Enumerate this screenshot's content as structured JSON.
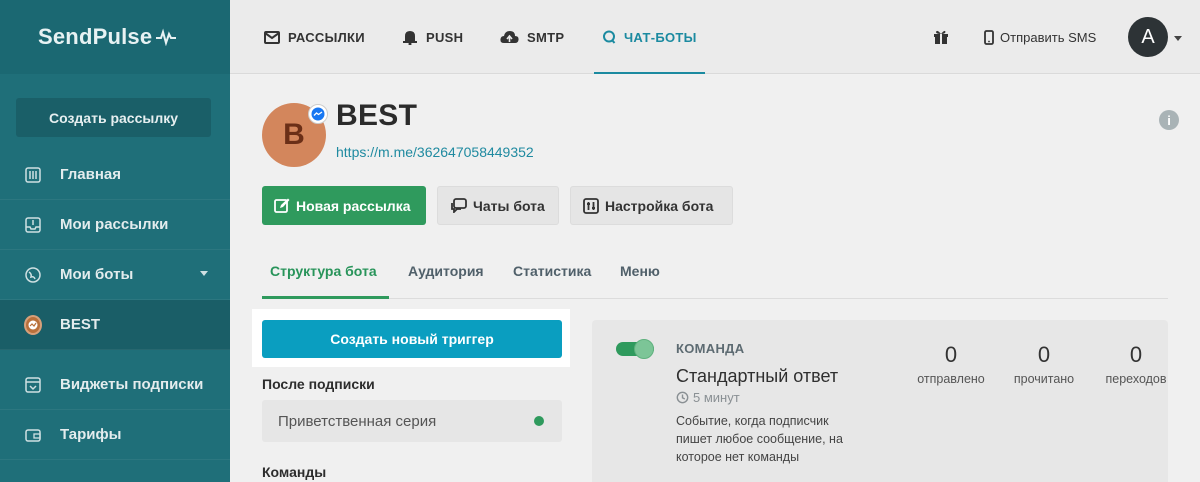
{
  "brand": {
    "name": "SendPulse"
  },
  "sidebar": {
    "create_label": "Создать рассылку",
    "items": [
      {
        "label": "Главная",
        "icon": "sliders-icon"
      },
      {
        "label": "Мои рассылки",
        "icon": "inbox-icon"
      },
      {
        "label": "Мои боты",
        "icon": "globe-icon"
      },
      {
        "label": "BEST",
        "icon": "messenger-icon"
      },
      {
        "label": "Виджеты подписки",
        "icon": "widget-icon"
      },
      {
        "label": "Тарифы",
        "icon": "wallet-icon"
      }
    ]
  },
  "header": {
    "tabs": [
      {
        "label": "РАССЫЛКИ",
        "icon": "envelope-icon"
      },
      {
        "label": "PUSH",
        "icon": "bell-icon"
      },
      {
        "label": "SMTP",
        "icon": "cloud-upload-icon"
      },
      {
        "label": "ЧАТ-БОТЫ",
        "icon": "chat-icon"
      }
    ],
    "sms_label": "Отправить SMS",
    "avatar_letter": "A"
  },
  "bot": {
    "initial": "B",
    "title": "BEST",
    "link": "https://m.me/362647058449352"
  },
  "actions": {
    "new_mailing": "Новая рассылка",
    "bot_chats": "Чаты бота",
    "bot_settings": "Настройка бота"
  },
  "subtabs": [
    "Структура бота",
    "Аудитория",
    "Статистика",
    "Меню"
  ],
  "triggers": {
    "create_label": "Создать новый триггер",
    "after_subscribe_label": "После подписки",
    "welcome_series": "Приветственная серия",
    "commands_label": "Команды"
  },
  "card": {
    "type": "КОМАНДА",
    "title": "Стандартный ответ",
    "time": "5 минут",
    "description": "Событие, когда подписчик пишет любое сообщение, на которое нет команды",
    "stats": [
      {
        "value": "0",
        "label": "отправлено"
      },
      {
        "value": "0",
        "label": "прочитано"
      },
      {
        "value": "0",
        "label": "переходов"
      }
    ]
  },
  "colors": {
    "sidebar": "#1f6f79",
    "accent_blue": "#1b8aa0",
    "green": "#2f9a5d",
    "trigger_blue": "#0a9ec0"
  }
}
